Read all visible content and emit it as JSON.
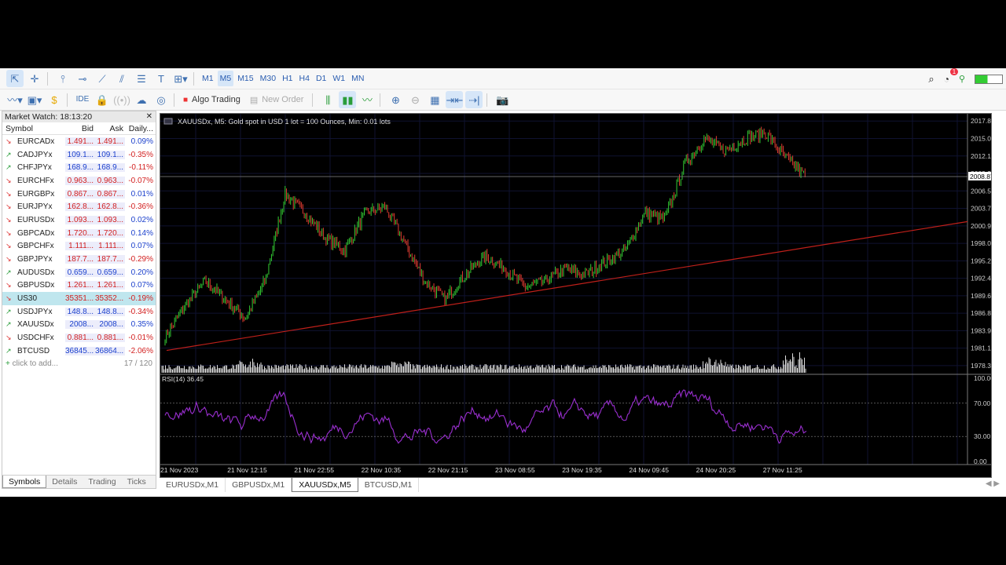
{
  "timeframes": [
    "M1",
    "M5",
    "M15",
    "M30",
    "H1",
    "H4",
    "D1",
    "W1",
    "MN"
  ],
  "active_timeframe": "M5",
  "toolbar2": {
    "ide": "IDE",
    "algo": "Algo Trading",
    "new_order": "New Order"
  },
  "notification_count": "1",
  "market_watch": {
    "title": "Market Watch: 18:13:20",
    "columns": [
      "Symbol",
      "Bid",
      "Ask",
      "Daily..."
    ],
    "rows": [
      {
        "symbol": "EURCADx",
        "bid": "1.491...",
        "ask": "1.491...",
        "daily": "0.09%",
        "dir": "down"
      },
      {
        "symbol": "CADJPYx",
        "bid": "109.1...",
        "ask": "109.1...",
        "daily": "-0.35%",
        "dir": "up"
      },
      {
        "symbol": "CHFJPYx",
        "bid": "168.9...",
        "ask": "168.9...",
        "daily": "-0.11%",
        "dir": "up"
      },
      {
        "symbol": "EURCHFx",
        "bid": "0.963...",
        "ask": "0.963...",
        "daily": "-0.07%",
        "dir": "down"
      },
      {
        "symbol": "EURGBPx",
        "bid": "0.867...",
        "ask": "0.867...",
        "daily": "0.01%",
        "dir": "down"
      },
      {
        "symbol": "EURJPYx",
        "bid": "162.8...",
        "ask": "162.8...",
        "daily": "-0.36%",
        "dir": "down"
      },
      {
        "symbol": "EURUSDx",
        "bid": "1.093...",
        "ask": "1.093...",
        "daily": "0.02%",
        "dir": "down"
      },
      {
        "symbol": "GBPCADx",
        "bid": "1.720...",
        "ask": "1.720...",
        "daily": "0.14%",
        "dir": "down"
      },
      {
        "symbol": "GBPCHFx",
        "bid": "1.111...",
        "ask": "1.111...",
        "daily": "0.07%",
        "dir": "down"
      },
      {
        "symbol": "GBPJPYx",
        "bid": "187.7...",
        "ask": "187.7...",
        "daily": "-0.29%",
        "dir": "down"
      },
      {
        "symbol": "AUDUSDx",
        "bid": "0.659...",
        "ask": "0.659...",
        "daily": "0.20%",
        "dir": "up"
      },
      {
        "symbol": "GBPUSDx",
        "bid": "1.261...",
        "ask": "1.261...",
        "daily": "0.07%",
        "dir": "down"
      },
      {
        "symbol": "US30",
        "bid": "35351...",
        "ask": "35352...",
        "daily": "-0.19%",
        "dir": "down",
        "highlight": true
      },
      {
        "symbol": "USDJPYx",
        "bid": "148.8...",
        "ask": "148.8...",
        "daily": "-0.34%",
        "dir": "up"
      },
      {
        "symbol": "XAUUSDx",
        "bid": "2008...",
        "ask": "2008...",
        "daily": "0.35%",
        "dir": "up"
      },
      {
        "symbol": "USDCHFx",
        "bid": "0.881...",
        "ask": "0.881...",
        "daily": "-0.01%",
        "dir": "down"
      },
      {
        "symbol": "BTCUSD",
        "bid": "36845...",
        "ask": "36864...",
        "daily": "-2.06%",
        "dir": "up"
      }
    ],
    "add_placeholder": "click to add...",
    "count": "17 / 120",
    "tabs": [
      "Symbols",
      "Details",
      "Trading",
      "Ticks"
    ]
  },
  "chart_data": {
    "type": "candlestick",
    "info": "XAUUSDx, M5:  Gold spot in USD 1 lot = 100 Ounces, Min: 0.01 lots",
    "price_ticks": [
      "2017.83",
      "2015.01",
      "2012.19",
      "2009.37",
      "2006.55",
      "2003.73",
      "2000.91",
      "1998.09",
      "1995.27",
      "1992.45",
      "1989.63",
      "1986.81",
      "1983.99",
      "1981.17",
      "1978.35"
    ],
    "ylim": [
      1977.2,
      2019.0
    ],
    "current_price": "2008.87",
    "x_labels": [
      "21 Nov 2023",
      "21 Nov 12:15",
      "21 Nov 22:55",
      "22 Nov 10:35",
      "22 Nov 21:15",
      "23 Nov 08:55",
      "23 Nov 19:35",
      "24 Nov 09:45",
      "24 Nov 20:25",
      "27 Nov 11:25"
    ],
    "trendline": {
      "from": 1980.8,
      "to": 2001.6
    },
    "price_keypoints": [
      1983,
      1988,
      1992,
      1989,
      1986,
      1992,
      2006,
      2003,
      1999,
      1997,
      2003,
      2004,
      1998,
      1992,
      1989,
      1993,
      1996,
      1994,
      1991,
      1992,
      1994,
      1993,
      1995,
      1997,
      2003,
      2002,
      2011,
      2015,
      2013,
      2015,
      2016,
      2012,
      2009
    ],
    "rsi": {
      "label": "RSI(14) 36.45",
      "levels": [
        "100.00",
        "70.00",
        "30.00",
        "0.00"
      ],
      "value": 36.45
    }
  },
  "chart_tabs": [
    "EURUSDx,M1",
    "GBPUSDx,M1",
    "XAUUSDx,M5",
    "BTCUSD,M1"
  ],
  "active_chart_tab": "XAUUSDx,M5",
  "colors": {
    "bull": "#33cc33",
    "bear": "#e03c31",
    "rsi": "#9a2fd0",
    "trend": "#c0201a"
  }
}
